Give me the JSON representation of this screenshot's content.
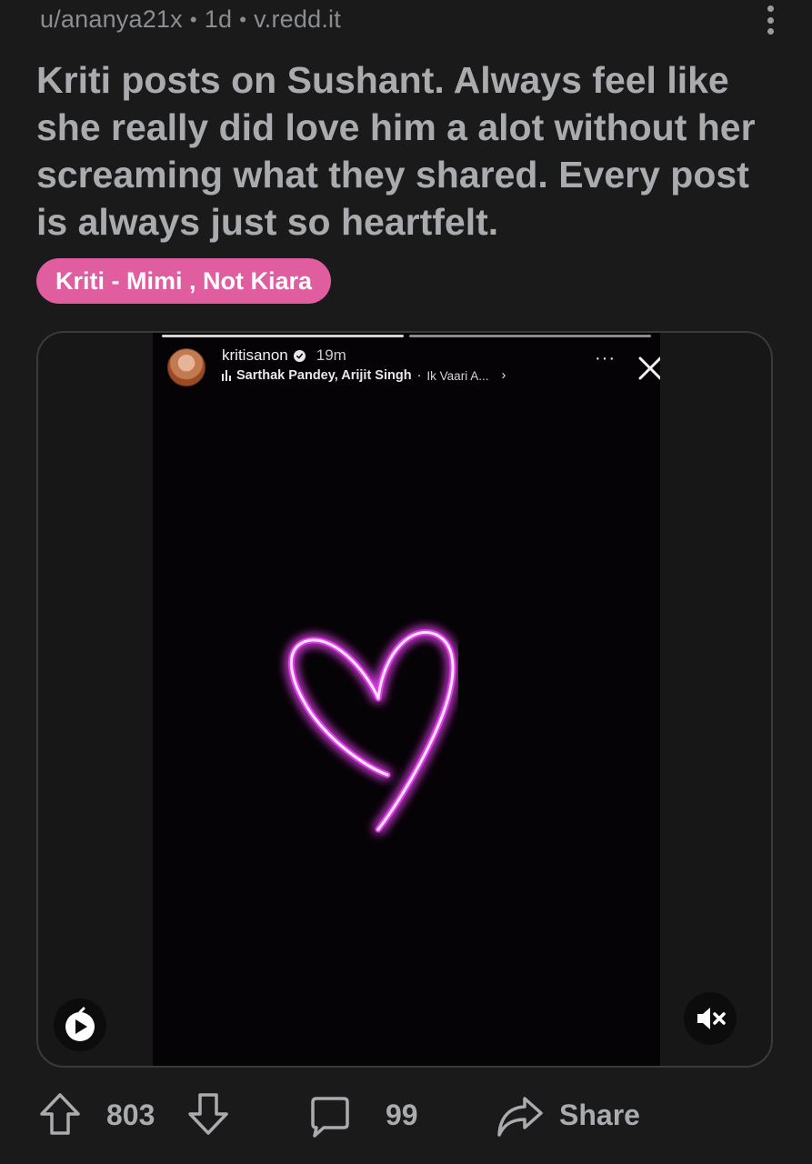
{
  "post": {
    "user": "u/ananya21x",
    "sep1": "•",
    "age": "1d",
    "sep2": "•",
    "domain": "v.redd.it",
    "title": "Kriti posts on Sushant. Always feel like she really did love him a alot without her screaming what they shared. Every post is always just so heartfelt.",
    "flair": "Kriti - Mimi , Not Kiara"
  },
  "story": {
    "username": "kritisanon",
    "time": "19m",
    "music_artists": "Sarthak Pandey, Arijit Singh",
    "music_sep": "·",
    "music_song": "Ik Vaari A...",
    "music_chevron": "›",
    "more": "···",
    "progress_segments": 2,
    "heart_color": "#e040e8"
  },
  "actions": {
    "upvotes": "803",
    "comments": "99",
    "share": "Share"
  },
  "colors": {
    "background": "#1a1a1b",
    "flair_bg": "#e05ea0",
    "text_muted": "#8b8d90",
    "title_text": "#a9abae"
  }
}
